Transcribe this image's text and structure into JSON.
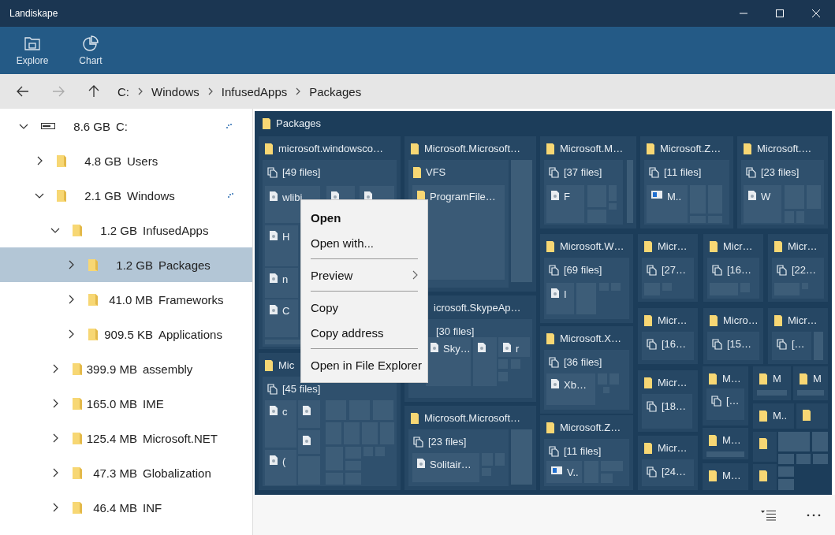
{
  "window": {
    "title": "Landiskape"
  },
  "toolbar": [
    {
      "kind": "explore",
      "label": "Explore"
    },
    {
      "kind": "chart",
      "label": "Chart"
    }
  ],
  "nav": [
    {
      "kind": "back",
      "disabled": false
    },
    {
      "kind": "forward",
      "disabled": true
    },
    {
      "kind": "up",
      "disabled": false
    }
  ],
  "breadcrumb": [
    "C:",
    "Windows",
    "InfusedApps",
    "Packages"
  ],
  "tree": [
    {
      "kind": "drive",
      "size": "8.6 GB",
      "name": "C:",
      "expanded": true,
      "selected": false,
      "scanning": true,
      "children": [
        {
          "kind": "folder",
          "size": "4.8 GB",
          "name": "Users",
          "expanded": false,
          "selected": false,
          "scanning": false
        },
        {
          "kind": "folder",
          "size": "2.1 GB",
          "name": "Windows",
          "expanded": true,
          "selected": false,
          "scanning": true,
          "children": [
            {
              "kind": "folder",
              "size": "1.2 GB",
              "name": "InfusedApps",
              "expanded": true,
              "selected": false,
              "scanning": false,
              "children": [
                {
                  "kind": "folder",
                  "size": "1.2 GB",
                  "name": "Packages",
                  "expanded": false,
                  "selected": true,
                  "scanning": false
                },
                {
                  "kind": "folder",
                  "size": "41.0 MB",
                  "name": "Frameworks",
                  "expanded": false,
                  "selected": false,
                  "scanning": false
                },
                {
                  "kind": "folder",
                  "size": "909.5 KB",
                  "name": "Applications",
                  "expanded": false,
                  "selected": false,
                  "scanning": false
                }
              ]
            },
            {
              "kind": "folder",
              "size": "399.9 MB",
              "name": "assembly",
              "expanded": false,
              "selected": false,
              "scanning": false
            },
            {
              "kind": "folder",
              "size": "165.0 MB",
              "name": "IME",
              "expanded": false,
              "selected": false,
              "scanning": false
            },
            {
              "kind": "folder",
              "size": "125.4 MB",
              "name": "Microsoft.NET",
              "expanded": false,
              "selected": false,
              "scanning": false
            },
            {
              "kind": "folder",
              "size": "47.3 MB",
              "name": "Globalization",
              "expanded": false,
              "selected": false,
              "scanning": false
            },
            {
              "kind": "folder",
              "size": "46.4 MB",
              "name": "INF",
              "expanded": false,
              "selected": false,
              "scanning": false
            }
          ]
        }
      ]
    }
  ],
  "treemap": {
    "title": "Packages",
    "tiles": [
      {
        "kind": "folder",
        "label": "microsoft.windowsco…",
        "group": {
          "kind": "files",
          "label": "[49 files]",
          "entries": [
            {
              "kind": "file",
              "label": "wlibi"
            },
            {
              "kind": "file"
            },
            {
              "kind": "file"
            },
            {
              "kind": "file",
              "label": "H"
            },
            {
              "kind": "file",
              "label": "n"
            },
            {
              "kind": "file",
              "label": "C"
            }
          ]
        }
      },
      {
        "kind": "folder",
        "label": "Mic",
        "group": {
          "kind": "files",
          "label": "[45 files]",
          "entries": [
            {
              "kind": "file",
              "label": "c"
            },
            {
              "kind": "file"
            },
            {
              "kind": "file"
            },
            {
              "kind": "file",
              "label": "("
            }
          ]
        }
      },
      {
        "kind": "folder",
        "label": "Microsoft.Microsoft…",
        "group": {
          "kind": "folder",
          "label": "VFS",
          "entries": [
            {
              "kind": "folder",
              "label": "ProgramFile…"
            }
          ]
        }
      },
      {
        "kind": "folder",
        "label": "icrosoft.SkypeAp…",
        "group": {
          "kind": "files",
          "label": "[30 files]",
          "entries": [
            {
              "kind": "file",
              "label": "Sky…"
            },
            {
              "kind": "file"
            },
            {
              "kind": "file",
              "label": "r"
            }
          ]
        }
      },
      {
        "kind": "folder",
        "label": "Microsoft.Microsoft…",
        "group": {
          "kind": "files",
          "label": "[23 files]",
          "entries": [
            {
              "kind": "file",
              "label": "Solitair…"
            }
          ]
        }
      },
      {
        "kind": "folder",
        "label": "Microsoft.M…",
        "group": {
          "kind": "files",
          "label": "[37 files]",
          "entries": [
            {
              "kind": "file",
              "label": "F"
            }
          ]
        }
      },
      {
        "kind": "folder",
        "label": "Microsoft.Z…",
        "group": {
          "kind": "files",
          "label": "[11 files]",
          "entries": [
            {
              "kind": "app",
              "label": "M.."
            }
          ]
        }
      },
      {
        "kind": "folder",
        "label": "Microsoft.…",
        "group": {
          "kind": "files",
          "label": "[23 files]",
          "entries": [
            {
              "kind": "file",
              "label": "W"
            }
          ]
        }
      },
      {
        "kind": "folder",
        "label": "Microsoft.W…",
        "group": {
          "kind": "files",
          "label": "[69 files]",
          "entries": [
            {
              "kind": "file",
              "label": "I"
            }
          ]
        }
      },
      {
        "kind": "folder",
        "label": "Micr…",
        "group": {
          "kind": "files",
          "label": "[27…"
        }
      },
      {
        "kind": "folder",
        "label": "Micr…",
        "group": {
          "kind": "files",
          "label": "[16…"
        }
      },
      {
        "kind": "folder",
        "label": "Micr…",
        "group": {
          "kind": "files",
          "label": "[22…"
        }
      },
      {
        "kind": "folder",
        "label": "Micr…",
        "group": {
          "kind": "files",
          "label": "[16…"
        }
      },
      {
        "kind": "folder",
        "label": "Micro…",
        "group": {
          "kind": "files",
          "label": "[15…"
        }
      },
      {
        "kind": "folder",
        "label": "Micr…",
        "group": {
          "kind": "files",
          "label": "[…"
        }
      },
      {
        "kind": "folder",
        "label": "Microsoft.X…",
        "group": {
          "kind": "files",
          "label": "[36 files]",
          "entries": [
            {
              "kind": "file",
              "label": "Xb…"
            }
          ]
        }
      },
      {
        "kind": "folder",
        "label": "Microsoft.Z…",
        "group": {
          "kind": "files",
          "label": "[11 files]",
          "entries": [
            {
              "kind": "app",
              "label": "V.."
            }
          ]
        }
      },
      {
        "kind": "folder",
        "label": "Micr…",
        "group": {
          "kind": "files",
          "label": "[18…"
        }
      },
      {
        "kind": "folder",
        "label": "Micr…",
        "group": {
          "kind": "files",
          "label": "[24…"
        }
      },
      {
        "kind": "folder",
        "label": "M…",
        "group": {
          "kind": "files",
          "label": "[…"
        }
      },
      {
        "kind": "folder",
        "label": "M"
      },
      {
        "kind": "folder",
        "label": "M"
      },
      {
        "kind": "folder",
        "label": "M.."
      },
      {
        "kind": "folder"
      },
      {
        "kind": "folder",
        "label": "M…"
      },
      {
        "kind": "folder",
        "label": "M…"
      },
      {
        "kind": "folder"
      },
      {
        "kind": "folder"
      }
    ]
  },
  "context_menu": [
    {
      "kind": "item",
      "label": "Open",
      "default": true,
      "submenu": false
    },
    {
      "kind": "item",
      "label": "Open with...",
      "default": false,
      "submenu": false
    },
    {
      "kind": "separator"
    },
    {
      "kind": "item",
      "label": "Preview",
      "default": false,
      "submenu": true
    },
    {
      "kind": "separator"
    },
    {
      "kind": "item",
      "label": "Copy",
      "default": false,
      "submenu": false
    },
    {
      "kind": "item",
      "label": "Copy address",
      "default": false,
      "submenu": false
    },
    {
      "kind": "separator"
    },
    {
      "kind": "item",
      "label": "Open in File Explorer",
      "default": false,
      "submenu": false
    }
  ]
}
